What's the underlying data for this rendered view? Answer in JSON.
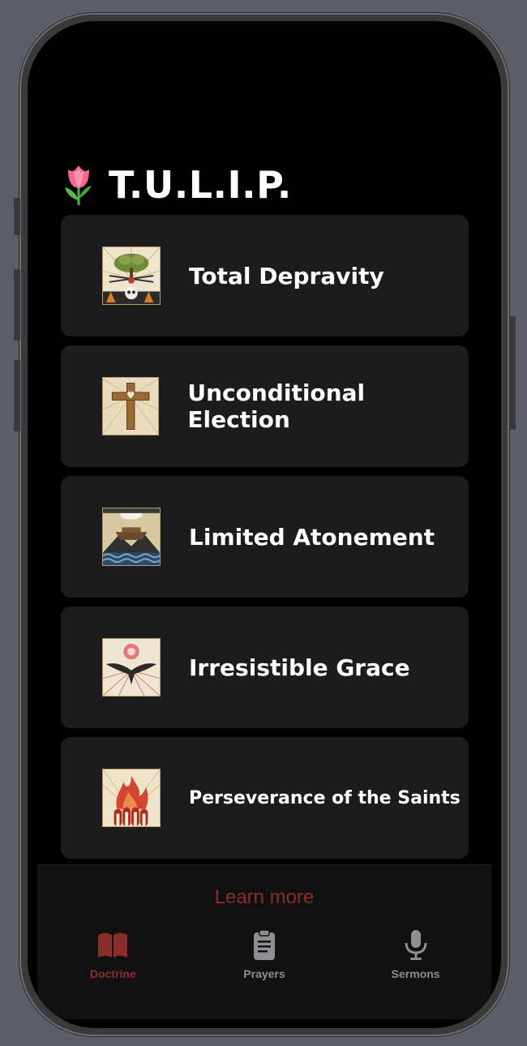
{
  "header": {
    "emoji": "🌷",
    "title": "T.U.L.I.P."
  },
  "points": [
    {
      "label": "Total Depravity",
      "icon": "tree-skull-image"
    },
    {
      "label": "Unconditional Election",
      "icon": "cross-image"
    },
    {
      "label": "Limited Atonement",
      "icon": "ark-image"
    },
    {
      "label": "Irresistible Grace",
      "icon": "dove-image"
    },
    {
      "label": "Perseverance of the Saints",
      "icon": "flame-saints-image"
    }
  ],
  "footer": {
    "learn_more": "Learn more"
  },
  "tabs": [
    {
      "label": "Doctrine",
      "icon": "book-icon",
      "active": true
    },
    {
      "label": "Prayers",
      "icon": "clipboard-icon",
      "active": false
    },
    {
      "label": "Sermons",
      "icon": "microphone-icon",
      "active": false
    }
  ],
  "colors": {
    "accent": "#8a2e2a",
    "card_bg": "#1c1c1e",
    "inactive_tab": "#8e8e93",
    "screen_bg": "#000000"
  }
}
